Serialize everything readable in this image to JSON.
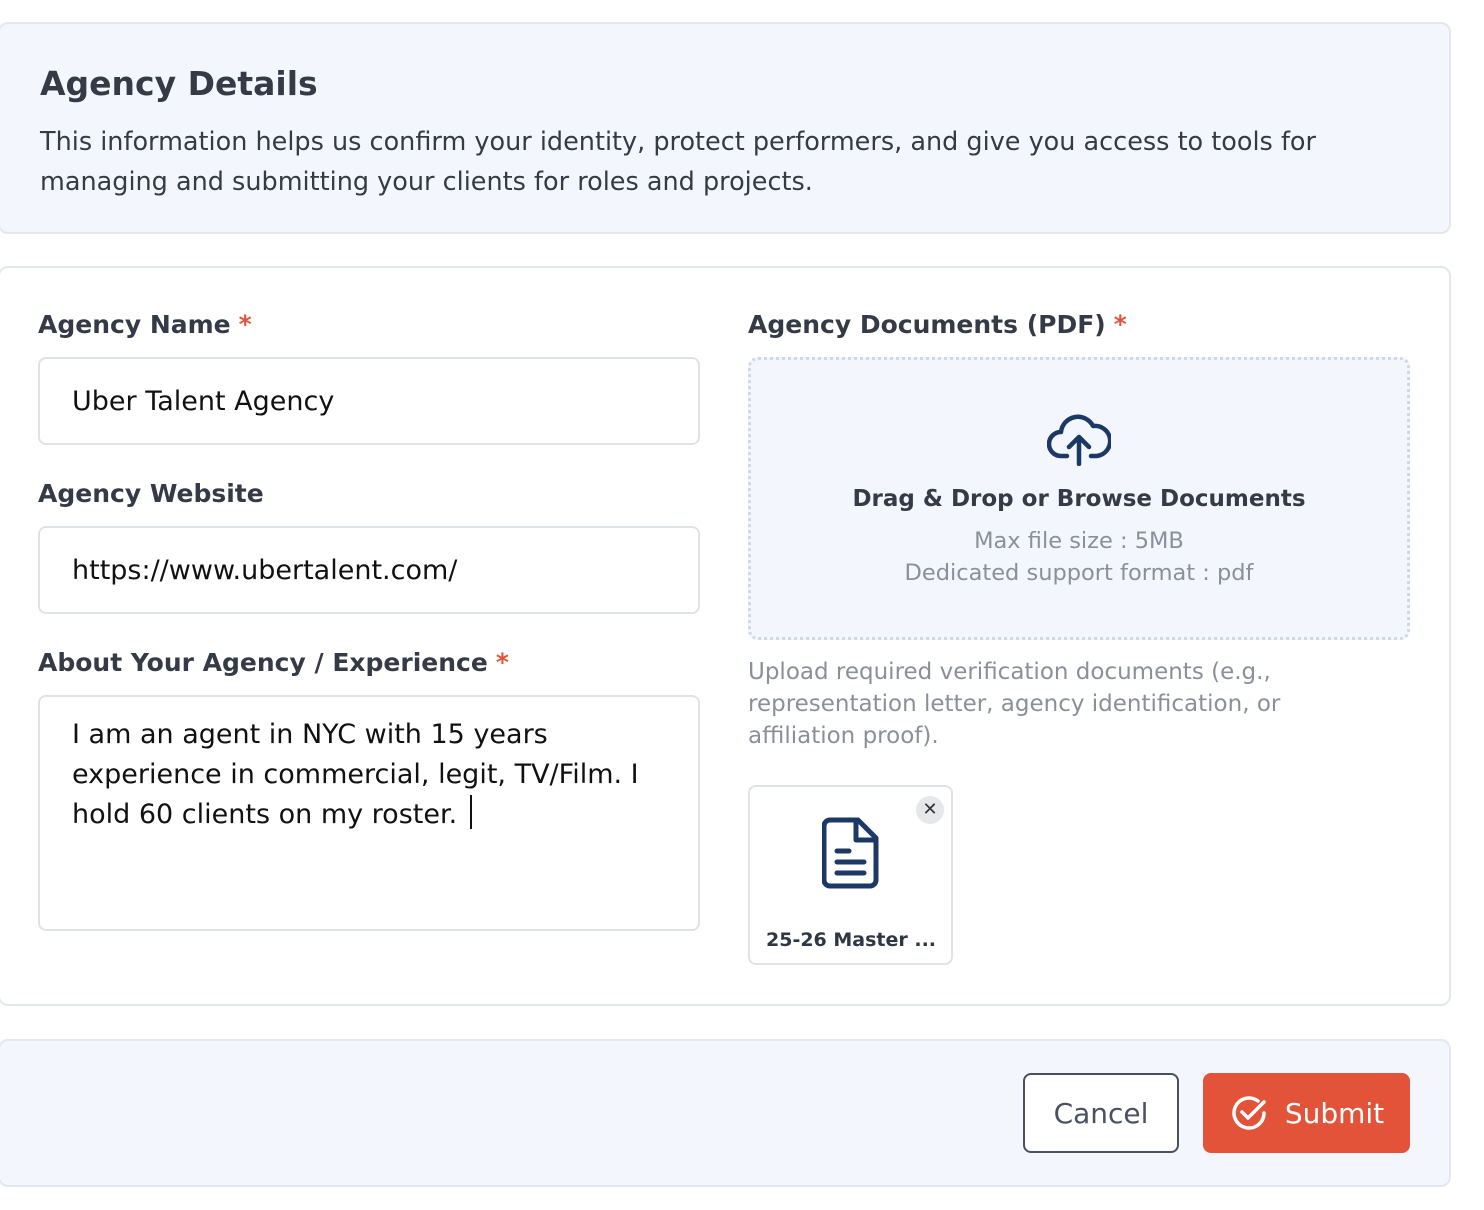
{
  "header": {
    "title": "Agency Details",
    "description": "This information helps us confirm your identity, protect performers, and give you access to tools for managing and submitting your clients for roles and projects."
  },
  "form": {
    "agency_name": {
      "label": "Agency Name",
      "required_mark": "*",
      "value": "Uber Talent Agency"
    },
    "agency_website": {
      "label": "Agency Website",
      "value": "https://www.ubertalent.com/"
    },
    "about": {
      "label": "About Your Agency / Experience",
      "required_mark": "*",
      "value": "I am an agent in NYC with 15 years experience in commercial, legit, TV/Film. I hold 60 clients on my roster. "
    },
    "documents": {
      "label": "Agency Documents (PDF)",
      "required_mark": "*",
      "dropzone_title": "Drag & Drop or Browse Documents",
      "max_size": "Max file size : 5MB",
      "format": "Dedicated support format : pdf",
      "help": "Upload required verification documents (e.g., representation letter, agency identification, or affiliation proof).",
      "files": [
        {
          "name": "25-26 Master ...",
          "icon": "file-document-icon"
        }
      ]
    }
  },
  "footer": {
    "cancel_label": "Cancel",
    "submit_label": "Submit"
  },
  "colors": {
    "accent": "#e2533a",
    "panel_bg": "#f3f7fd",
    "icon_navy": "#1c3966",
    "muted_text": "#8a909a"
  }
}
